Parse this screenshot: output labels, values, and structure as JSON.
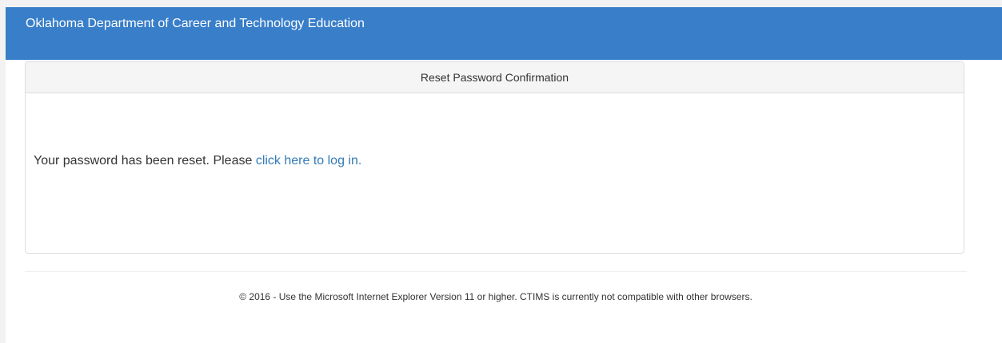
{
  "header": {
    "brand": "Oklahoma Department of Career and Technology Education"
  },
  "panel": {
    "title": "Reset Password Confirmation",
    "message": "Your password has been reset. Please ",
    "login_link": "click here to log in."
  },
  "footer": {
    "text": "© 2016 - Use the Microsoft Internet Explorer Version 11 or higher. CTIMS is currently not compatible with other browsers."
  },
  "colors": {
    "navbar": "#387ec9",
    "link": "#337ab7",
    "panel_heading": "#f5f5f5"
  }
}
